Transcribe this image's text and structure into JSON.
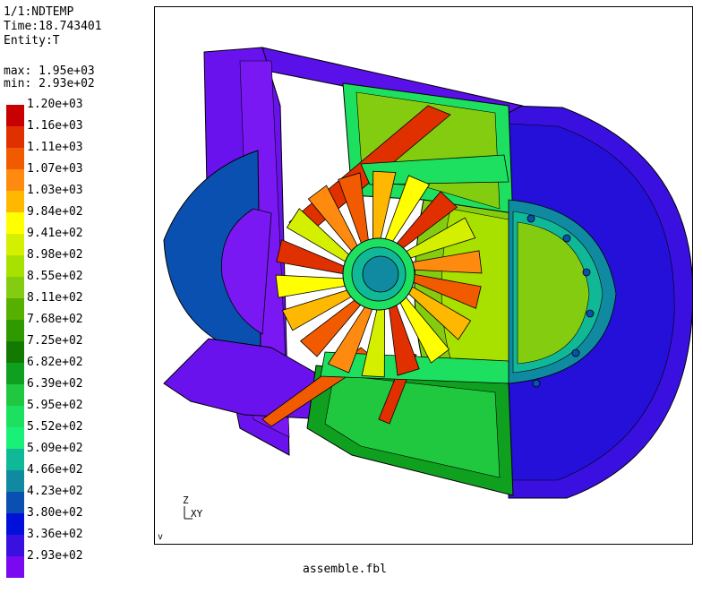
{
  "header": {
    "line1": "1/1:NDTEMP",
    "line2": "Time:18.743401",
    "line3": "Entity:T",
    "max_label": "max: 1.95e+03",
    "min_label": "min: 2.93e+02"
  },
  "legend": {
    "entries": [
      {
        "label": "1.20e+03",
        "color": "#c80000"
      },
      {
        "label": "1.16e+03",
        "color": "#e03000"
      },
      {
        "label": "1.11e+03",
        "color": "#f25a00"
      },
      {
        "label": "1.07e+03",
        "color": "#ff8a10"
      },
      {
        "label": "1.03e+03",
        "color": "#ffb800"
      },
      {
        "label": "9.84e+02",
        "color": "#ffff00"
      },
      {
        "label": "9.41e+02",
        "color": "#d4f000"
      },
      {
        "label": "8.98e+02",
        "color": "#a8e000"
      },
      {
        "label": "8.55e+02",
        "color": "#84cc10"
      },
      {
        "label": "8.11e+02",
        "color": "#56b000"
      },
      {
        "label": "7.68e+02",
        "color": "#2e9a00"
      },
      {
        "label": "7.25e+02",
        "color": "#127a00"
      },
      {
        "label": "6.82e+02",
        "color": "#10a020"
      },
      {
        "label": "6.39e+02",
        "color": "#20c840"
      },
      {
        "label": "5.95e+02",
        "color": "#1ee060"
      },
      {
        "label": "5.52e+02",
        "color": "#18f078"
      },
      {
        "label": "5.09e+02",
        "color": "#10b898"
      },
      {
        "label": "4.66e+02",
        "color": "#108aa0"
      },
      {
        "label": "4.23e+02",
        "color": "#0a50b0"
      },
      {
        "label": "3.80e+02",
        "color": "#0010d8"
      },
      {
        "label": "3.36e+02",
        "color": "#3a10e0"
      },
      {
        "label": "2.93e+02",
        "color": "#7a08f0"
      }
    ]
  },
  "viewport": {
    "axis_z": "Z",
    "axis_xy": "XY",
    "corner_mark": "v"
  },
  "footer": {
    "filename": "assemble.fbl"
  }
}
